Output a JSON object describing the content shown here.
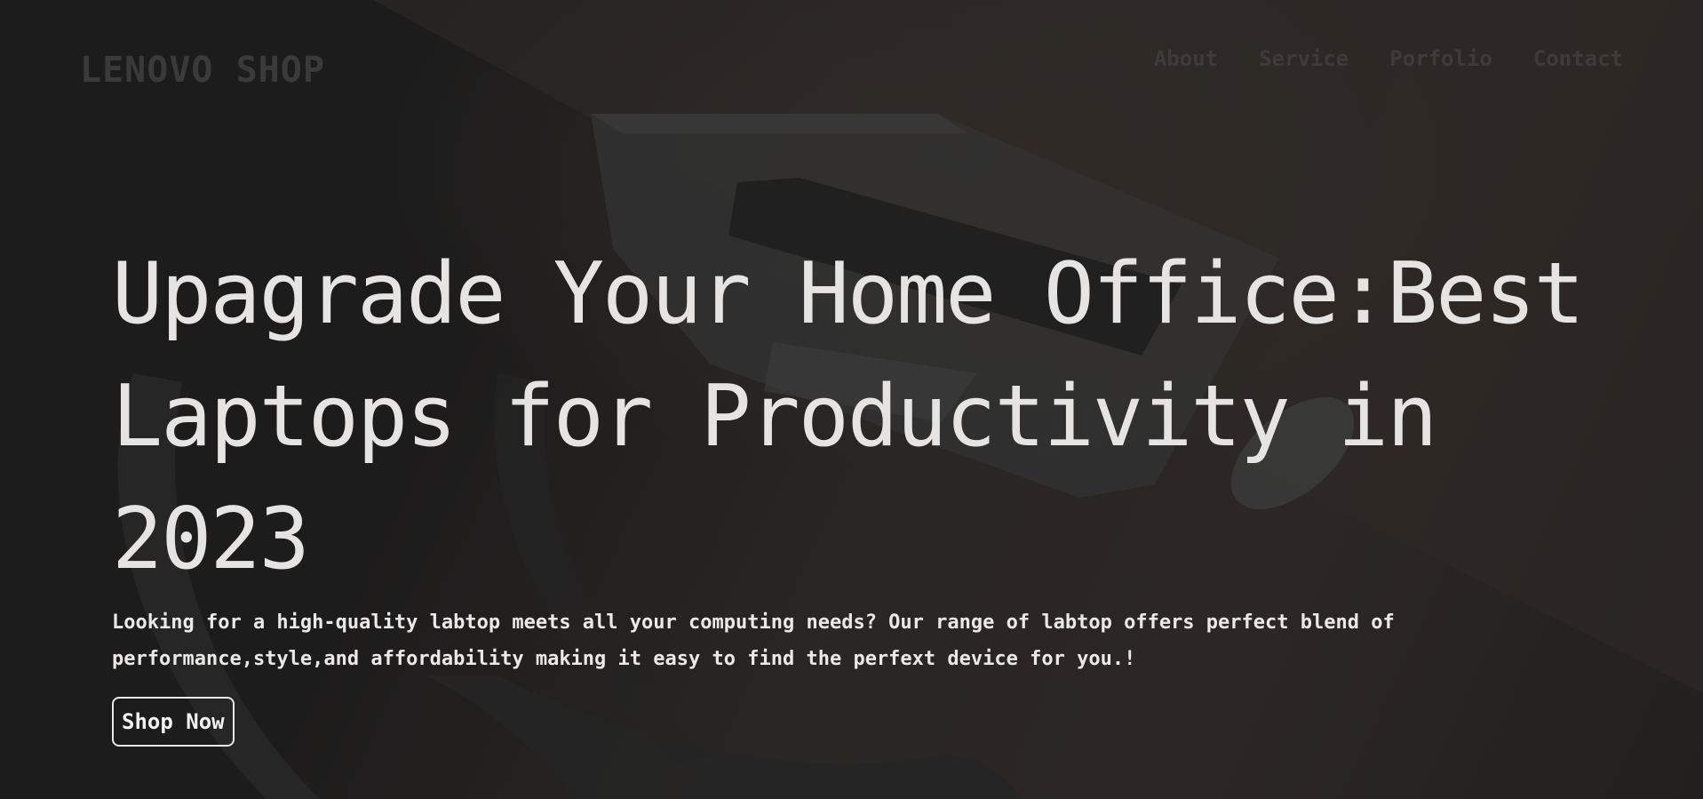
{
  "brand": {
    "logo_text": "LENOVO SHOP"
  },
  "nav": {
    "items": [
      "About",
      "Service",
      "Porfolio",
      "Contact"
    ]
  },
  "hero": {
    "headline_lines": [
      "Upagrade Your Home Office:Best",
      "Laptops for Productivity in",
      "2023"
    ],
    "description_lines": [
      "Looking for a high-quality labtop meets all your computing needs? Our range of labtop offers perfect blend of",
      "performance,style,and affordability making it easy to find the perfext device for you.!"
    ],
    "cta_label": "Shop Now",
    "background_image": "dark desk with laptop and mouse",
    "colors": {
      "overlay": "#1b1b1c",
      "text": "#e6e4e3",
      "muted_nav": "#3d3c3b"
    }
  }
}
